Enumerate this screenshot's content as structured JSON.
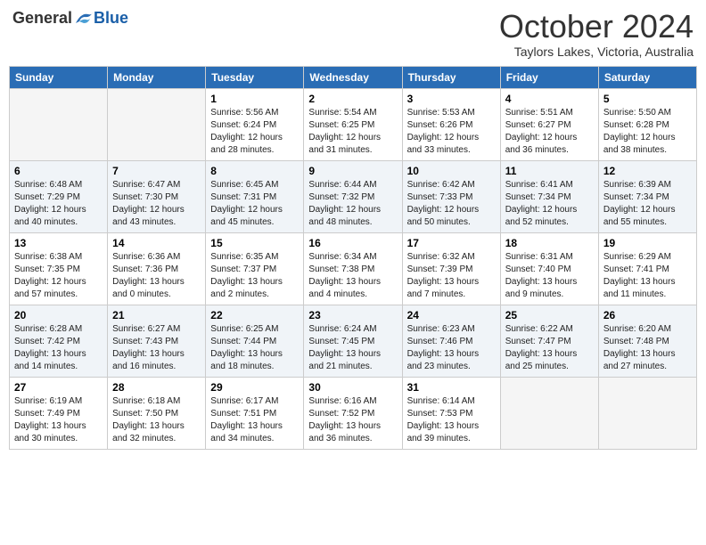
{
  "logo": {
    "general": "General",
    "blue": "Blue"
  },
  "title": "October 2024",
  "location": "Taylors Lakes, Victoria, Australia",
  "days_of_week": [
    "Sunday",
    "Monday",
    "Tuesday",
    "Wednesday",
    "Thursday",
    "Friday",
    "Saturday"
  ],
  "weeks": [
    [
      {
        "num": "",
        "info": ""
      },
      {
        "num": "",
        "info": ""
      },
      {
        "num": "1",
        "info": "Sunrise: 5:56 AM\nSunset: 6:24 PM\nDaylight: 12 hours and 28 minutes."
      },
      {
        "num": "2",
        "info": "Sunrise: 5:54 AM\nSunset: 6:25 PM\nDaylight: 12 hours and 31 minutes."
      },
      {
        "num": "3",
        "info": "Sunrise: 5:53 AM\nSunset: 6:26 PM\nDaylight: 12 hours and 33 minutes."
      },
      {
        "num": "4",
        "info": "Sunrise: 5:51 AM\nSunset: 6:27 PM\nDaylight: 12 hours and 36 minutes."
      },
      {
        "num": "5",
        "info": "Sunrise: 5:50 AM\nSunset: 6:28 PM\nDaylight: 12 hours and 38 minutes."
      }
    ],
    [
      {
        "num": "6",
        "info": "Sunrise: 6:48 AM\nSunset: 7:29 PM\nDaylight: 12 hours and 40 minutes."
      },
      {
        "num": "7",
        "info": "Sunrise: 6:47 AM\nSunset: 7:30 PM\nDaylight: 12 hours and 43 minutes."
      },
      {
        "num": "8",
        "info": "Sunrise: 6:45 AM\nSunset: 7:31 PM\nDaylight: 12 hours and 45 minutes."
      },
      {
        "num": "9",
        "info": "Sunrise: 6:44 AM\nSunset: 7:32 PM\nDaylight: 12 hours and 48 minutes."
      },
      {
        "num": "10",
        "info": "Sunrise: 6:42 AM\nSunset: 7:33 PM\nDaylight: 12 hours and 50 minutes."
      },
      {
        "num": "11",
        "info": "Sunrise: 6:41 AM\nSunset: 7:34 PM\nDaylight: 12 hours and 52 minutes."
      },
      {
        "num": "12",
        "info": "Sunrise: 6:39 AM\nSunset: 7:34 PM\nDaylight: 12 hours and 55 minutes."
      }
    ],
    [
      {
        "num": "13",
        "info": "Sunrise: 6:38 AM\nSunset: 7:35 PM\nDaylight: 12 hours and 57 minutes."
      },
      {
        "num": "14",
        "info": "Sunrise: 6:36 AM\nSunset: 7:36 PM\nDaylight: 13 hours and 0 minutes."
      },
      {
        "num": "15",
        "info": "Sunrise: 6:35 AM\nSunset: 7:37 PM\nDaylight: 13 hours and 2 minutes."
      },
      {
        "num": "16",
        "info": "Sunrise: 6:34 AM\nSunset: 7:38 PM\nDaylight: 13 hours and 4 minutes."
      },
      {
        "num": "17",
        "info": "Sunrise: 6:32 AM\nSunset: 7:39 PM\nDaylight: 13 hours and 7 minutes."
      },
      {
        "num": "18",
        "info": "Sunrise: 6:31 AM\nSunset: 7:40 PM\nDaylight: 13 hours and 9 minutes."
      },
      {
        "num": "19",
        "info": "Sunrise: 6:29 AM\nSunset: 7:41 PM\nDaylight: 13 hours and 11 minutes."
      }
    ],
    [
      {
        "num": "20",
        "info": "Sunrise: 6:28 AM\nSunset: 7:42 PM\nDaylight: 13 hours and 14 minutes."
      },
      {
        "num": "21",
        "info": "Sunrise: 6:27 AM\nSunset: 7:43 PM\nDaylight: 13 hours and 16 minutes."
      },
      {
        "num": "22",
        "info": "Sunrise: 6:25 AM\nSunset: 7:44 PM\nDaylight: 13 hours and 18 minutes."
      },
      {
        "num": "23",
        "info": "Sunrise: 6:24 AM\nSunset: 7:45 PM\nDaylight: 13 hours and 21 minutes."
      },
      {
        "num": "24",
        "info": "Sunrise: 6:23 AM\nSunset: 7:46 PM\nDaylight: 13 hours and 23 minutes."
      },
      {
        "num": "25",
        "info": "Sunrise: 6:22 AM\nSunset: 7:47 PM\nDaylight: 13 hours and 25 minutes."
      },
      {
        "num": "26",
        "info": "Sunrise: 6:20 AM\nSunset: 7:48 PM\nDaylight: 13 hours and 27 minutes."
      }
    ],
    [
      {
        "num": "27",
        "info": "Sunrise: 6:19 AM\nSunset: 7:49 PM\nDaylight: 13 hours and 30 minutes."
      },
      {
        "num": "28",
        "info": "Sunrise: 6:18 AM\nSunset: 7:50 PM\nDaylight: 13 hours and 32 minutes."
      },
      {
        "num": "29",
        "info": "Sunrise: 6:17 AM\nSunset: 7:51 PM\nDaylight: 13 hours and 34 minutes."
      },
      {
        "num": "30",
        "info": "Sunrise: 6:16 AM\nSunset: 7:52 PM\nDaylight: 13 hours and 36 minutes."
      },
      {
        "num": "31",
        "info": "Sunrise: 6:14 AM\nSunset: 7:53 PM\nDaylight: 13 hours and 39 minutes."
      },
      {
        "num": "",
        "info": ""
      },
      {
        "num": "",
        "info": ""
      }
    ]
  ]
}
